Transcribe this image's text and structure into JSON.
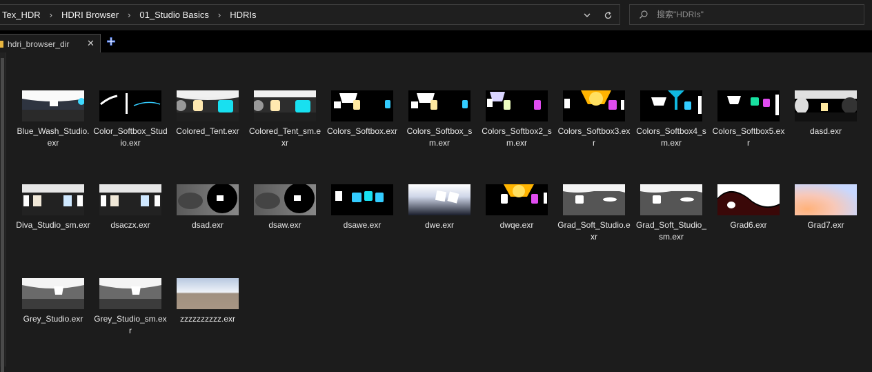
{
  "breadcrumbs": [
    "Tex_HDR",
    "HDRI Browser",
    "01_Studio Basics",
    "HDRIs"
  ],
  "search": {
    "placeholder": "搜索\"HDRIs\""
  },
  "tab": {
    "label": "hdri_browser_dir"
  },
  "icons": {
    "dropdown": "chevron-down-icon",
    "refresh": "refresh-icon",
    "search": "search-icon",
    "folder": "folder-icon",
    "close": "close-icon",
    "add": "plus-icon"
  },
  "colors": {
    "accent": "#4f7df0",
    "folder": "#e8b640"
  },
  "files": [
    "Blue_Wash_Studio.exr",
    "Color_Softbox_Studio.exr",
    "Colored_Tent.exr",
    "Colored_Tent_sm.exr",
    "Colors_Softbox.exr",
    "Colors_Softbox_sm.exr",
    "Colors_Softbox2_sm.exr",
    "Colors_Softbox3.exr",
    "Colors_Softbox4_sm.exr",
    "Colors_Softbox5.exr",
    "dasd.exr",
    "Diva_Studio_sm.exr",
    "dsaczx.exr",
    "dsad.exr",
    "dsaw.exr",
    "dsawe.exr",
    "dwe.exr",
    "dwqe.exr",
    "Grad_Soft_Studio.exr",
    "Grad_Soft_Studio_sm.exr",
    "Grad6.exr",
    "Grad7.exr",
    "Grey_Studio.exr",
    "Grey_Studio_sm.exr",
    "zzzzzzzzzz.exr"
  ]
}
